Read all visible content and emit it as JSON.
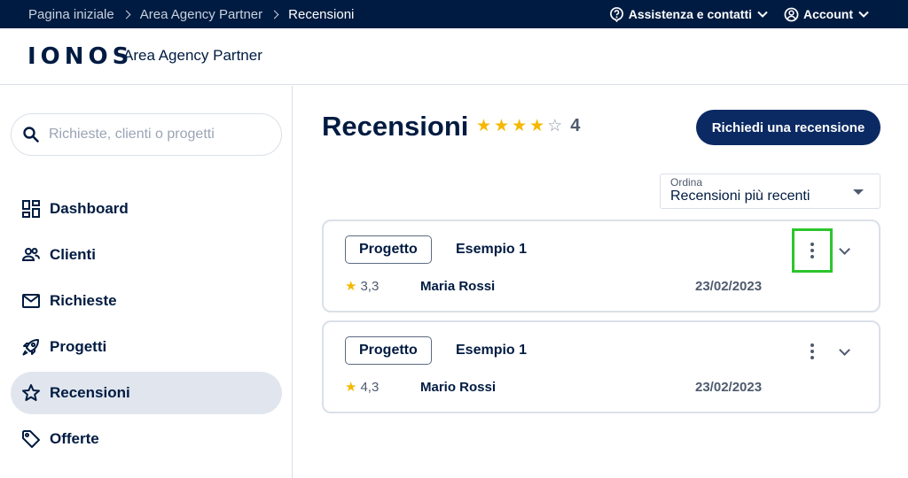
{
  "breadcrumb": [
    "Pagina iniziale",
    "Area Agency Partner",
    "Recensioni"
  ],
  "topbar": {
    "help_label": "Assistenza e contatti",
    "account_label": "Account"
  },
  "header": {
    "logo": "IONOS",
    "app_name": "Area Agency Partner"
  },
  "search": {
    "placeholder": "Richieste, clienti o progetti"
  },
  "nav": [
    {
      "label": "Dashboard",
      "icon": "dashboard-icon",
      "active": false
    },
    {
      "label": "Clienti",
      "icon": "people-icon",
      "active": false
    },
    {
      "label": "Richieste",
      "icon": "mail-icon",
      "active": false
    },
    {
      "label": "Progetti",
      "icon": "rocket-icon",
      "active": false
    },
    {
      "label": "Recensioni",
      "icon": "star-icon",
      "active": true
    },
    {
      "label": "Offerte",
      "icon": "tag-icon",
      "active": false
    }
  ],
  "main": {
    "title": "Recensioni",
    "rating": {
      "stars": 4,
      "max": 5,
      "value": "4"
    },
    "request_button": "Richiedi una recensione",
    "sort": {
      "label": "Ordina",
      "value": "Recensioni più recenti"
    },
    "reviews": [
      {
        "tag": "Progetto",
        "project": "Esempio 1",
        "score": "3,3",
        "author": "Maria Rossi",
        "date": "23/02/2023",
        "menu_highlighted": true
      },
      {
        "tag": "Progetto",
        "project": "Esempio 1",
        "score": "4,3",
        "author": "Mario Rossi",
        "date": "23/02/2023",
        "menu_highlighted": false
      }
    ]
  },
  "colors": {
    "navy": "#001b41",
    "button": "#0b2a63",
    "star": "#f5b800",
    "highlight": "#2dc52d"
  }
}
